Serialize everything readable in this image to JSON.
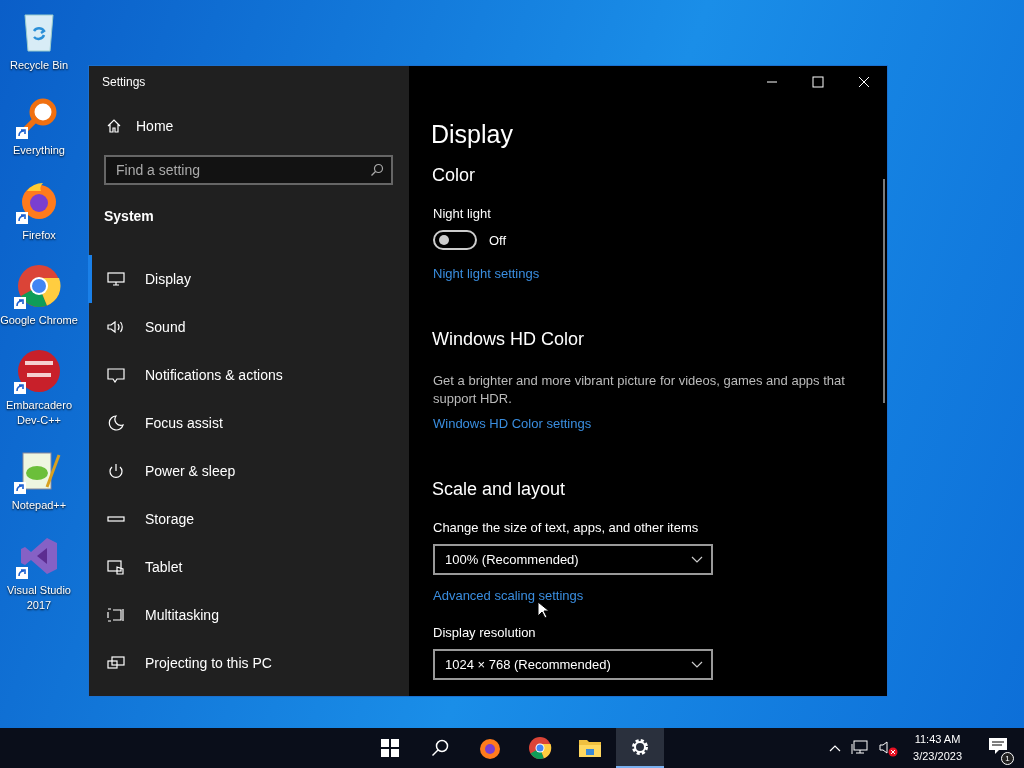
{
  "desktop_icons": [
    {
      "label": "Recycle Bin",
      "kind": "bin"
    },
    {
      "label": "Everything",
      "kind": "magnifier"
    },
    {
      "label": "Firefox",
      "kind": "firefox"
    },
    {
      "label": "Google Chrome",
      "kind": "chrome"
    },
    {
      "label": "Embarcadero Dev-C++",
      "kind": "devcpp"
    },
    {
      "label": "Notepad++",
      "kind": "notepad"
    },
    {
      "label": "Visual Studio 2017",
      "kind": "vs"
    }
  ],
  "window": {
    "title": "Settings"
  },
  "sidebar": {
    "home": "Home",
    "search": {
      "placeholder": "Find a setting"
    },
    "section": "System",
    "items": [
      {
        "label": "Display",
        "selected": true
      },
      {
        "label": "Sound",
        "selected": false
      },
      {
        "label": "Notifications & actions",
        "selected": false
      },
      {
        "label": "Focus assist",
        "selected": false
      },
      {
        "label": "Power & sleep",
        "selected": false
      },
      {
        "label": "Storage",
        "selected": false
      },
      {
        "label": "Tablet",
        "selected": false
      },
      {
        "label": "Multitasking",
        "selected": false
      },
      {
        "label": "Projecting to this PC",
        "selected": false
      }
    ]
  },
  "content": {
    "title": "Display",
    "color": {
      "heading": "Color",
      "night_light": {
        "label": "Night light",
        "on": false,
        "state": "Off"
      },
      "link": "Night light settings"
    },
    "hd_color": {
      "heading": "Windows HD Color",
      "description": "Get a brighter and more vibrant picture for videos, games and apps that support HDR.",
      "link": "Windows HD Color settings"
    },
    "scale": {
      "heading": "Scale and layout",
      "size_label": "Change the size of text, apps, and other items",
      "size_value": "100% (Recommended)",
      "link": "Advanced scaling settings",
      "resolution_label": "Display resolution",
      "resolution_value": "1024 × 768 (Recommended)"
    }
  },
  "taskbar": {
    "apps": [
      {
        "kind": "start",
        "selected": false
      },
      {
        "kind": "search",
        "selected": false
      },
      {
        "kind": "firefox",
        "selected": false
      },
      {
        "kind": "chrome",
        "selected": false
      },
      {
        "kind": "explorer",
        "selected": false
      },
      {
        "kind": "settings",
        "selected": true
      }
    ],
    "time": "11:43 AM",
    "date": "3/23/2023",
    "notifications": "1"
  }
}
